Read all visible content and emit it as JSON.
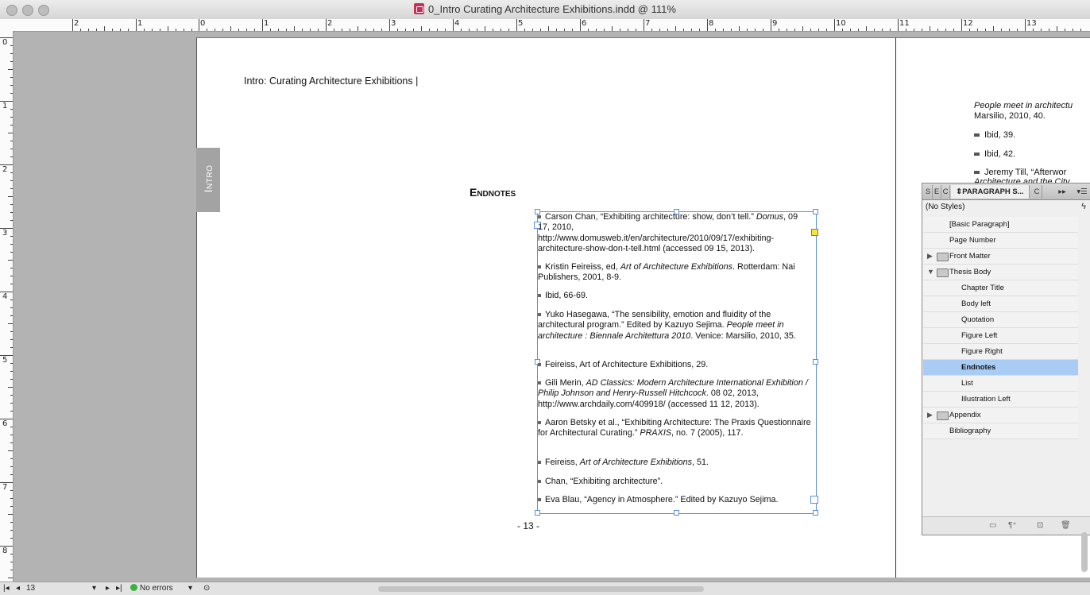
{
  "window": {
    "title": "0_Intro Curating Architecture Exhibitions.indd @ 111%"
  },
  "ruler": {
    "h_labels": [
      "2",
      "1",
      "0",
      "1",
      "2",
      "3",
      "4",
      "5",
      "6",
      "7",
      "8",
      "9",
      "10",
      "11",
      "12",
      "13"
    ],
    "v_labels": [
      "0",
      "1",
      "2",
      "3",
      "4",
      "5",
      "6",
      "7",
      "8"
    ]
  },
  "page": {
    "running_head": "Intro: Curating Architecture Exhibitions |",
    "section_tab": "Intro",
    "heading": "Endnotes",
    "page_number": "- 13 -",
    "notes": [
      {
        "parts": [
          {
            "t": "Carson Chan, “Exhibiting architecture: show, don’t tell.” "
          },
          {
            "t": "Domus",
            "i": true
          },
          {
            "t": ", 09 17, 2010, http://www.domusweb.it/en/architecture/2010/09/17/exhibiting-architecture-show-don-t-tell.html (accessed 09 15, 2013)."
          }
        ]
      },
      {
        "parts": [
          {
            "t": "Kristin Feireiss, ed, "
          },
          {
            "t": "Art of Architecture Exhibitions",
            "i": true
          },
          {
            "t": ". Rotterdam: Nai Publishers, 2001, 8-9."
          }
        ]
      },
      {
        "parts": [
          {
            "t": "Ibid, 66-69."
          }
        ]
      },
      {
        "parts": [
          {
            "t": "Yuko Hasegawa, “The sensibility, emotion and fluidity of the architectural program.” Edited by Kazuyo Sejima. "
          },
          {
            "t": "People meet in architecture : Biennale Architettura 2010",
            "i": true
          },
          {
            "t": ". Venice: Marsilio, 2010, 35."
          }
        ]
      },
      {
        "parts": [
          {
            "t": "Feireiss, Art of Architecture Exhibitions, 29."
          }
        ]
      },
      {
        "parts": [
          {
            "t": "Gili Merin, "
          },
          {
            "t": "AD Classics: Modern Architecture International Exhibition / Philip Johnson and Henry-Russell Hitchcock",
            "i": true
          },
          {
            "t": ". 08 02, 2013, http://www.archdaily.com/409918/ (accessed 11 12, 2013)."
          }
        ]
      },
      {
        "parts": [
          {
            "t": "Aaron Betsky et al., “Exhibiting Architecture: The Praxis Questionnaire for Architectural Curating.” "
          },
          {
            "t": "PRAXIS",
            "i": true
          },
          {
            "t": ", no. 7 (2005), 117."
          }
        ]
      },
      {
        "parts": [
          {
            "t": "Feireiss, "
          },
          {
            "t": "Art of Architecture Exhibitions",
            "i": true
          },
          {
            "t": ", 51."
          }
        ]
      },
      {
        "parts": [
          {
            "t": "Chan, “Exhibiting architecture”."
          }
        ]
      },
      {
        "parts": [
          {
            "t": "Eva Blau, “Agency in Atmosphere.” Edited by Kazuyo Sejima."
          }
        ]
      }
    ]
  },
  "page2": {
    "line1_italic": "People meet in architectu",
    "line2": "Marsilio, 2010, 40.",
    "items": [
      "Ibid, 39.",
      "Ibid, 42.",
      "Jeremy Till, “Afterwor"
    ],
    "line_cut": "Architecture and the City"
  },
  "panel": {
    "tabs": [
      "S",
      "E",
      "C",
      "PARAGRAPH S...",
      "C"
    ],
    "no_styles": "(No Styles)",
    "styles": [
      {
        "label": "[Basic Paragraph]",
        "level": 0
      },
      {
        "label": "Page Number",
        "level": 0
      },
      {
        "label": "Front Matter",
        "group": true,
        "open": false
      },
      {
        "label": "Thesis Body",
        "group": true,
        "open": true
      },
      {
        "label": "Chapter Title",
        "level": 1
      },
      {
        "label": "Body left",
        "level": 1
      },
      {
        "label": "Quotation",
        "level": 1
      },
      {
        "label": "Figure Left",
        "level": 1
      },
      {
        "label": "Figure Right",
        "level": 1
      },
      {
        "label": "Endnotes",
        "level": 1,
        "selected": true
      },
      {
        "label": "List",
        "level": 1
      },
      {
        "label": "Illustration Left",
        "level": 1
      },
      {
        "label": "Appendix",
        "group": true,
        "open": false
      },
      {
        "label": "Bibliography",
        "level": 0
      }
    ]
  },
  "status": {
    "page": "13",
    "errors": "No errors"
  },
  "colors": {
    "selection": "#a9ccf4",
    "frame": "#5b8fd6",
    "tab_bg": "#a3a3a3"
  }
}
